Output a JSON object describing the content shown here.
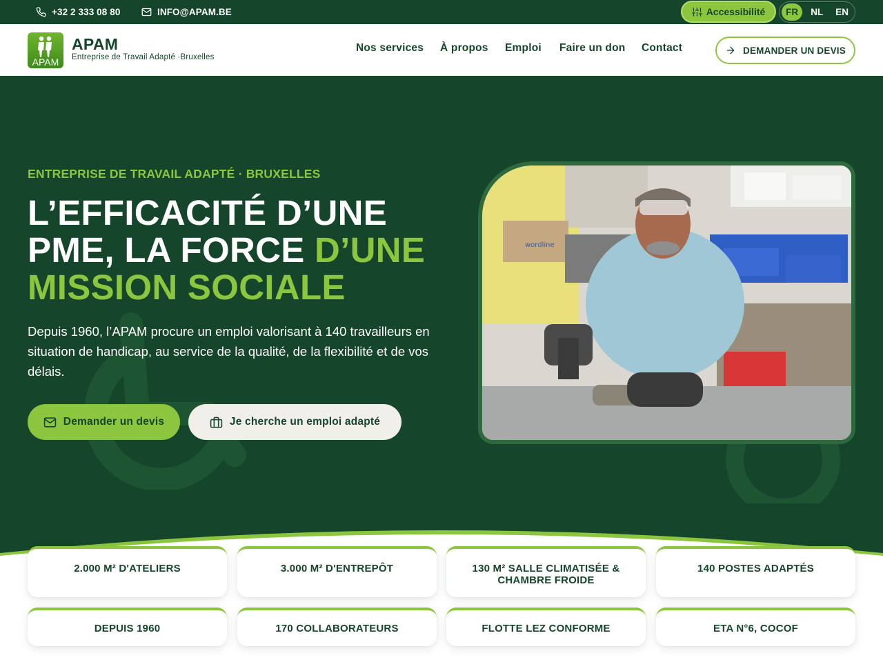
{
  "topbar": {
    "phone": "+32 2 333 08 80",
    "email": "INFO@APAM.BE",
    "accessibility_label": "Accessibilité",
    "languages": [
      "FR",
      "NL",
      "EN"
    ],
    "active_language": "FR"
  },
  "header": {
    "logo_text": "APAM",
    "brand_name": "APAM",
    "brand_subtitle": "Entreprise de Travail Adapté ·Bruxelles",
    "nav": [
      "Nos services",
      "À propos",
      "Emploi",
      "Faire un don",
      "Contact"
    ],
    "cta_label": "DEMANDER UN DEVIS"
  },
  "hero": {
    "kicker": "ENTREPRISE DE TRAVAIL ADAPTÉ · BRUXELLES",
    "headline_white": "L’EFFICACITÉ D’UNE PME, LA FORCE",
    "headline_green": "D’UNE MISSION SOCIALE",
    "lead": "Depuis 1960, l’APAM procure un emploi valorisant à 140 travailleurs en situation de handicap, au service de la qualité, de la flexibilité et de vos délais.",
    "primary_button": "Demander un devis",
    "secondary_button": "Je cherche un emploi adapté",
    "photo_box_text": "wordline"
  },
  "stats": [
    "2.000 M² D'ATELIERS",
    "3.000 M² D'ENTREPÔT",
    "130 M² SALLE CLIMATISÉE & CHAMBRE FROIDE",
    "140 POSTES ADAPTÉS",
    "DEPUIS 1960",
    "170 COLLABORATEURS",
    "FLOTTE LEZ CONFORME",
    "ETA N°6, COCOF"
  ],
  "colors": {
    "brand_dark_green": "#15452a",
    "accent_green": "#8cc63f",
    "secondary_button_bg": "#f1efea"
  },
  "icons": {
    "phone": "phone-icon",
    "email": "mail-icon",
    "accessibility": "sliders-icon",
    "cta": "arrow-right-icon",
    "primary": "mail-icon",
    "secondary": "briefcase-icon"
  }
}
